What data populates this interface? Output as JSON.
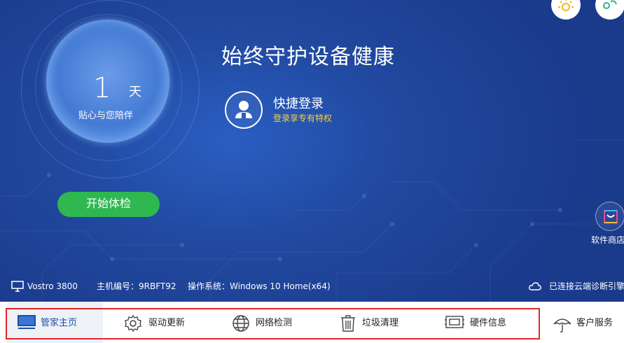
{
  "hero": {
    "days_number": "1",
    "days_unit": "天",
    "days_caption": "贴心与您陪伴",
    "start_button": "开始体检",
    "headline": "始终守护设备健康",
    "login_title": "快捷登录",
    "login_subtitle": "登录享专有特权"
  },
  "side": {
    "store_label": "软件商店"
  },
  "info_bar": {
    "model": "Vostro 3800",
    "serial": "主机编号：9RBFT92",
    "os": "操作系统：Windows 10 Home(x64)",
    "cloud_status": "已连接云端诊断引擎"
  },
  "nav": {
    "items": [
      {
        "label": "管家主页",
        "icon": "monitor-icon"
      },
      {
        "label": "驱动更新",
        "icon": "gear-icon"
      },
      {
        "label": "网络检测",
        "icon": "globe-icon"
      },
      {
        "label": "垃圾清理",
        "icon": "trash-icon"
      },
      {
        "label": "硬件信息",
        "icon": "hardware-icon"
      }
    ],
    "service_label": "客户服务"
  },
  "colors": {
    "background": "#1c3f95",
    "accent_green": "#2eb84f",
    "highlight_red": "#e0272b",
    "login_sub_yellow": "#f5d23c"
  }
}
